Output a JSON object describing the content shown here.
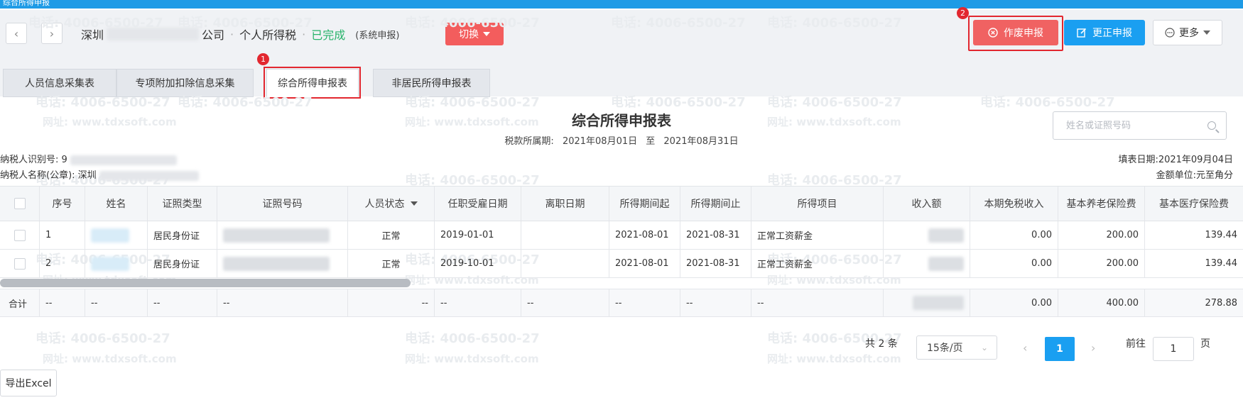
{
  "window": {
    "title": "综合所得申报"
  },
  "header": {
    "location": "深圳",
    "company_suffix": "公司",
    "tax_type": "个人所得税",
    "status": "已完成",
    "status_color": "#27b36a",
    "declare_mode": "(系统申报)",
    "switch_label": "切换",
    "void_label": "作废申报",
    "correct_label": "更正申报",
    "more_label": "更多",
    "void_badge": "2",
    "tab_badge": "1"
  },
  "tabs": [
    {
      "label": "人员信息采集表"
    },
    {
      "label": "专项附加扣除信息采集"
    },
    {
      "label": "综合所得申报表"
    },
    {
      "label": "非居民所得申报表"
    }
  ],
  "report": {
    "title": "综合所得申报表",
    "period_label": "税款所属期:",
    "period_start": "2021年08月01日",
    "period_sep": "至",
    "period_end": "2021年08月31日",
    "search_placeholder": "姓名或证照号码",
    "taxpayer_id_label": "纳税人识别号:",
    "taxpayer_id_value": "9",
    "taxpayer_name_label": "纳税人名称(公章):",
    "taxpayer_name_value": "深圳",
    "fill_date": "填表日期:2021年09月04日",
    "unit": "金额单位:元至角分"
  },
  "table": {
    "columns": [
      "序号",
      "姓名",
      "证照类型",
      "证照号码",
      "人员状态",
      "任职受雇日期",
      "离职日期",
      "所得期间起",
      "所得期间止",
      "所得项目",
      "收入额",
      "本期免税收入",
      "基本养老保险费",
      "基本医疗保险费"
    ],
    "rows": [
      {
        "no": "1",
        "id_type": "居民身份证",
        "status": "正常",
        "hire_date": "2019-01-01",
        "leave_date": "",
        "period_start": "2021-08-01",
        "period_end": "2021-08-31",
        "item": "正常工资薪金",
        "tax_free": "0.00",
        "pension": "200.00",
        "medical": "139.44"
      },
      {
        "no": "2",
        "id_type": "居民身份证",
        "status": "正常",
        "hire_date": "2019-10-01",
        "leave_date": "",
        "period_start": "2021-08-01",
        "period_end": "2021-08-31",
        "item": "正常工资薪金",
        "tax_free": "0.00",
        "pension": "200.00",
        "medical": "139.44"
      }
    ],
    "total": {
      "label": "合计",
      "dash": "--",
      "tax_free": "0.00",
      "pension": "400.00",
      "medical": "278.88"
    }
  },
  "pagination": {
    "total": "共 2 条",
    "page_size": "15条/页",
    "current_page": "1",
    "goto_label": "前往",
    "goto_value": "1",
    "page_unit": "页"
  },
  "export_label": "导出Excel",
  "watermark": {
    "phone": "电话: 4006-6500-27",
    "url": "网址: www.tdxsoft.com"
  }
}
